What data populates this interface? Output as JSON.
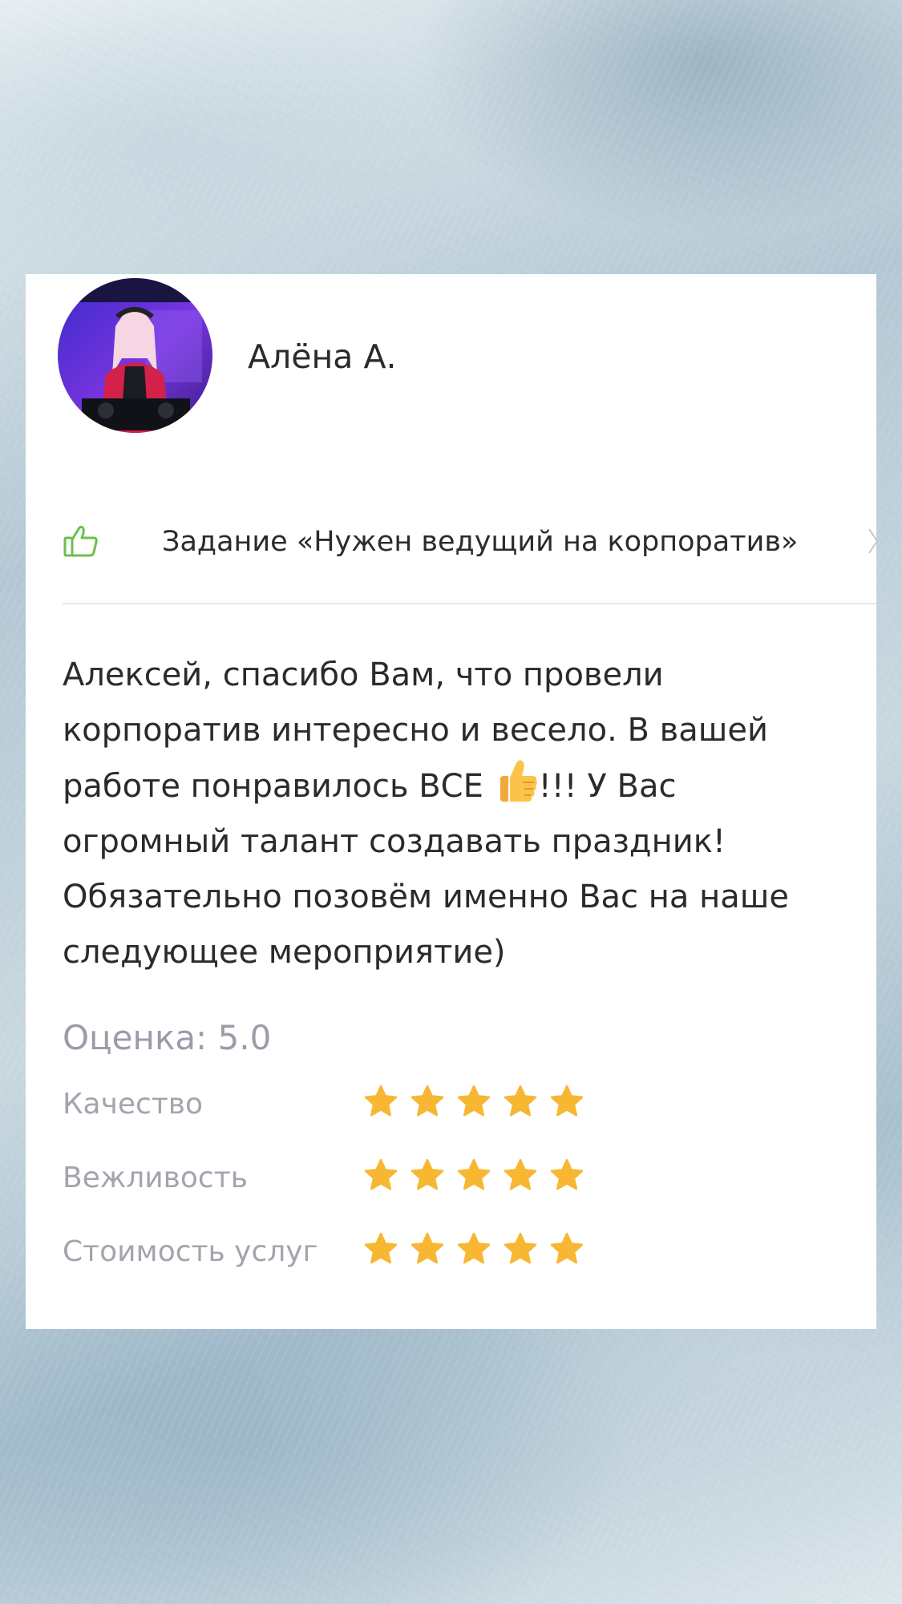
{
  "review": {
    "user_name": "Алёна А.",
    "task_label": "Задание «Нужен ведущий на корпоратив»",
    "text_before_emoji": "Алексей, спасибо Вам, что провели корпоратив интересно и весело. В вашей работе понравилось ВСЕ ",
    "emoji": "thumbs-up-emoji",
    "text_after_emoji": "!!! У Вас огромный талант создавать праздник! Обязательно позовём именно Вас на наше следующее мероприятие)",
    "rating_total": "Оценка: 5.0",
    "ratings": [
      {
        "label": "Качество",
        "stars": 5
      },
      {
        "label": "Вежливость",
        "stars": 5
      },
      {
        "label": "Стоимость услуг",
        "stars": 5
      }
    ]
  },
  "colors": {
    "accent_green": "#6cc04a",
    "star": "#f7b733",
    "text": "#2b2b2b",
    "muted": "#a6a3ae"
  },
  "icons": {
    "task": "thumbs-up-outline-icon",
    "chevron": "chevron-right-icon",
    "star": "star-icon"
  }
}
